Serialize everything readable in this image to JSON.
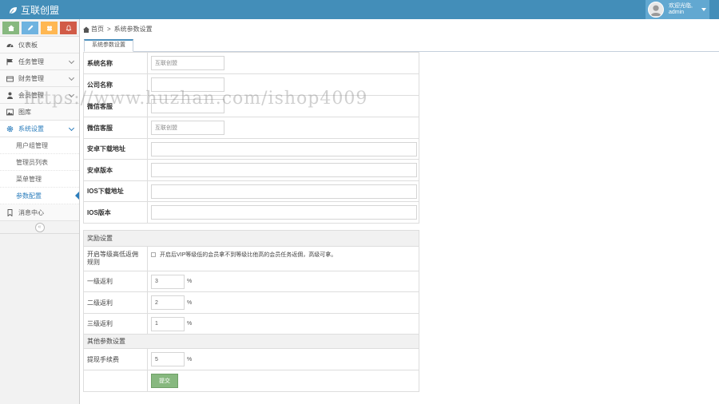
{
  "header": {
    "brand": "互联创盟",
    "welcome": "欢迎光临,",
    "username": "admin"
  },
  "sidebar": {
    "shortcuts": [
      {
        "icon": "home-icon",
        "color": "#87b87f"
      },
      {
        "icon": "pencil-icon",
        "color": "#6fb3e0"
      },
      {
        "icon": "users-icon",
        "color": "#ffb752"
      },
      {
        "icon": "bell-icon",
        "color": "#d15b47"
      }
    ],
    "items": [
      {
        "label": "仪表板",
        "icon": "dashboard-icon"
      },
      {
        "label": "任务管理",
        "icon": "flag-icon"
      },
      {
        "label": "财务管理",
        "icon": "wallet-icon"
      },
      {
        "label": "会员管理",
        "icon": "user-icon"
      },
      {
        "label": "图库",
        "icon": "picture-icon"
      },
      {
        "label": "系统设置",
        "icon": "gear-icon"
      }
    ],
    "sub_items": [
      "用户组管理",
      "管理员列表",
      "菜单管理",
      "参数配置"
    ],
    "message_center": {
      "label": "消息中心",
      "icon": "bookmark-icon"
    }
  },
  "breadcrumb": {
    "home": "首页",
    "separator": ">",
    "current": "系统参数设置"
  },
  "tab": {
    "label": "系统参数设置"
  },
  "basic_form": [
    {
      "label": "系统名称",
      "value": "互联创盟"
    },
    {
      "label": "公司名称",
      "value": ""
    },
    {
      "label": "微信客服",
      "value": ""
    },
    {
      "label": "微信客服",
      "value": "互联创盟"
    },
    {
      "label": "安卓下载地址",
      "value": ""
    },
    {
      "label": "安卓版本",
      "value": ""
    },
    {
      "label": "IOS下载地址",
      "value": ""
    },
    {
      "label": "IOS版本",
      "value": ""
    }
  ],
  "reward": {
    "section_title": "奖励设置",
    "rule_label": "开启等级高低返佣规则",
    "rule_text": "开启后VIP等级低的会员拿不到等级比他高的会员任务返佣，高级可拿。",
    "rows": [
      {
        "label": "一级返利",
        "value": "3",
        "unit": "%"
      },
      {
        "label": "二级返利",
        "value": "2",
        "unit": "%"
      },
      {
        "label": "三级返利",
        "value": "1",
        "unit": "%"
      }
    ]
  },
  "other": {
    "section_title": "其他参数设置",
    "fee_label": "提现手续费",
    "fee_value": "5",
    "fee_unit": "%",
    "submit_label": "提交"
  },
  "watermark": "https://www.huzhan.com/ishop4009"
}
